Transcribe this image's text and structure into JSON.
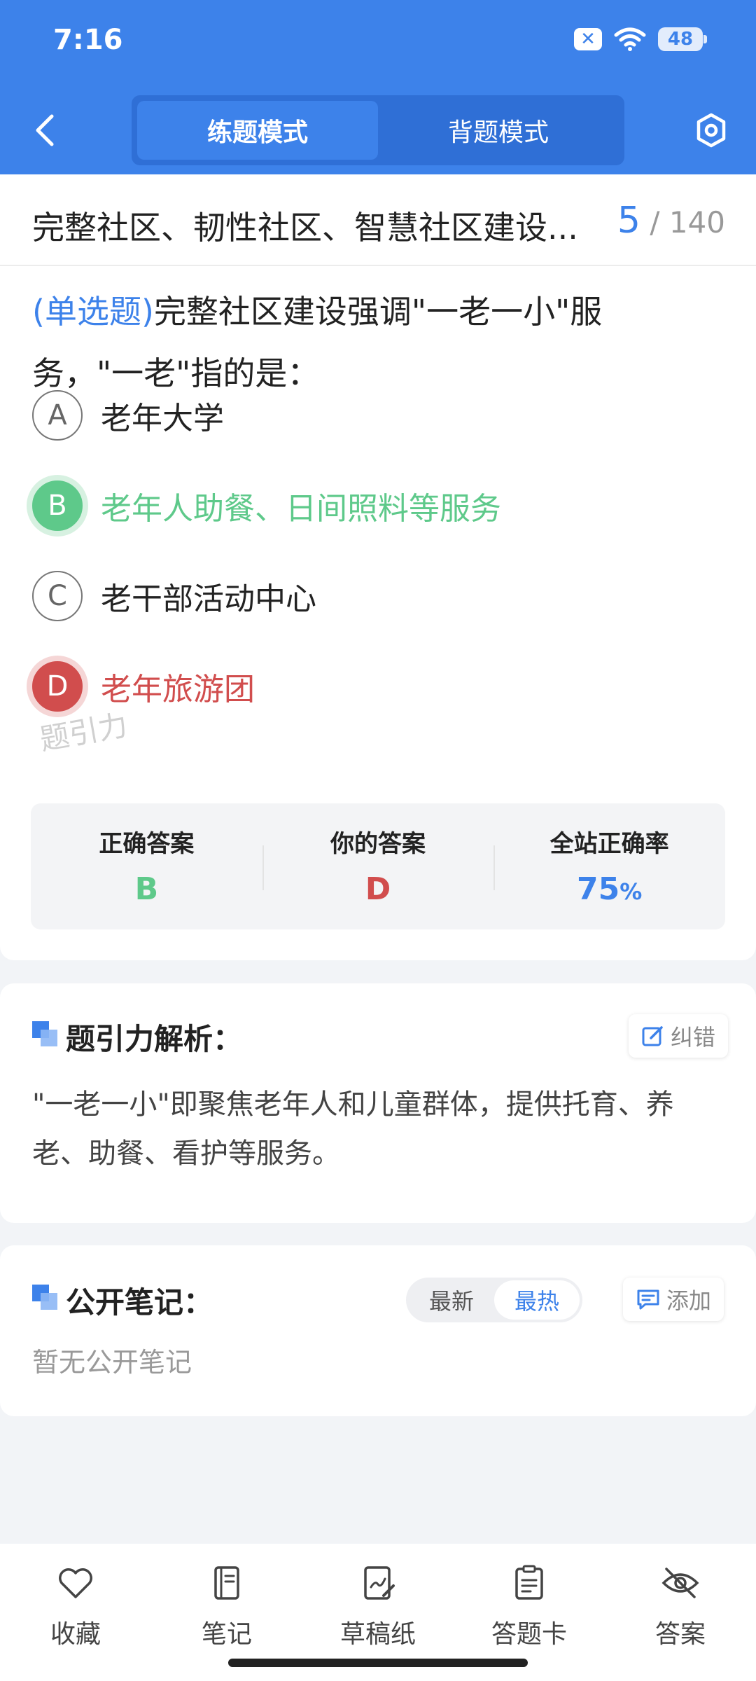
{
  "status": {
    "time": "7:16",
    "battery": "48"
  },
  "header": {
    "tabs": [
      {
        "label": "练题模式",
        "active": true
      },
      {
        "label": "背题模式",
        "active": false
      }
    ]
  },
  "question": {
    "chapter_title": "完整社区、韧性社区、智慧社区建设...",
    "current": "5",
    "total": "/ 140",
    "type_label": "(单选题)",
    "stem": "完整社区建设强调\"一老一小\"服务，\"一老\"指的是：",
    "options": [
      {
        "letter": "A",
        "text": "老年大学",
        "state": "normal"
      },
      {
        "letter": "B",
        "text": "老年人助餐、日间照料等服务",
        "state": "correct"
      },
      {
        "letter": "C",
        "text": "老干部活动中心",
        "state": "normal"
      },
      {
        "letter": "D",
        "text": "老年旅游团",
        "state": "wrong"
      }
    ],
    "result": {
      "correct_label": "正确答案",
      "correct_value": "B",
      "yours_label": "你的答案",
      "yours_value": "D",
      "rate_label": "全站正确率",
      "rate_value": "75",
      "rate_unit": "%"
    },
    "watermark": "题引力"
  },
  "analysis": {
    "title": "题引力解析：",
    "correct_button": "纠错",
    "text": "\"一老一小\"即聚焦老年人和儿童群体，提供托育、养老、助餐、看护等服务。"
  },
  "notes": {
    "title": "公开笔记：",
    "sort_options": [
      {
        "label": "最新",
        "active": false
      },
      {
        "label": "最热",
        "active": true
      }
    ],
    "add_button": "添加",
    "empty_text": "暂无公开笔记"
  },
  "bottom_nav": [
    {
      "label": "收藏",
      "icon": "heart-icon"
    },
    {
      "label": "笔记",
      "icon": "notebook-icon"
    },
    {
      "label": "草稿纸",
      "icon": "draft-paper-icon"
    },
    {
      "label": "答题卡",
      "icon": "answer-sheet-icon"
    },
    {
      "label": "答案",
      "icon": "eye-off-icon"
    }
  ],
  "colors": {
    "primary": "#3d82ea",
    "correct": "#5ec98a",
    "wrong": "#d14d4d"
  }
}
